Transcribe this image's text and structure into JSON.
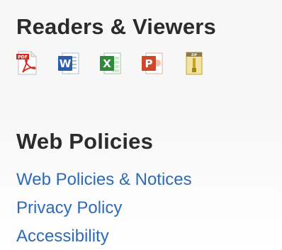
{
  "readers_section": {
    "title": "Readers & Viewers",
    "icons": [
      {
        "name": "pdf-reader-icon",
        "label": "PDF",
        "color": "#d42b1f"
      },
      {
        "name": "word-viewer-icon",
        "label": "W",
        "color": "#2a5db0"
      },
      {
        "name": "excel-viewer-icon",
        "label": "X",
        "color": "#2f8a3a"
      },
      {
        "name": "powerpoint-viewer-icon",
        "label": "P",
        "color": "#d24726"
      },
      {
        "name": "zip-archive-icon",
        "label": "ZIP",
        "color": "#c9a227"
      }
    ]
  },
  "web_policies": {
    "title": "Web Policies",
    "links": [
      {
        "label": "Web Policies & Notices"
      },
      {
        "label": "Privacy Policy"
      },
      {
        "label": "Accessibility"
      }
    ]
  },
  "colors": {
    "heading": "#2b2b2b",
    "link": "#2d6bb8"
  }
}
